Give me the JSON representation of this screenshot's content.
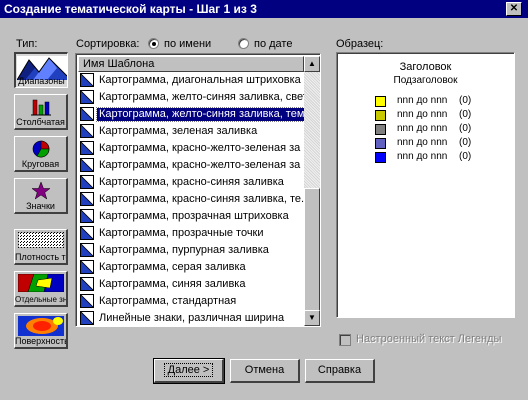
{
  "window": {
    "title": "Создание тематической карты - Шаг 1 из 3",
    "close_glyph": "✕"
  },
  "type_panel": {
    "label": "Тип:",
    "buttons": [
      {
        "label": "Диапазоны",
        "icon": "ranges-icon",
        "selected": true
      },
      {
        "label": "Столбчатая",
        "icon": "bar-chart-icon"
      },
      {
        "label": "Круговая",
        "icon": "pie-chart-icon"
      },
      {
        "label": "Значки",
        "icon": "star-symbol-icon"
      },
      {
        "label": "Плотность точек",
        "icon": "dot-density-icon"
      },
      {
        "label": "Отдельные значения",
        "icon": "individual-values-icon"
      },
      {
        "label": "Поверхность",
        "icon": "grid-surface-icon"
      }
    ]
  },
  "sort": {
    "label": "Сортировка:",
    "by_name": "по имени",
    "by_date": "по дате",
    "selected": "by_name"
  },
  "template_list": {
    "header": "Имя Шаблона",
    "items": [
      "Картограмма, диагональная штриховка",
      "Картограмма, желто-синяя заливка, свет",
      "Картограмма, желто-синяя заливка, тем",
      "Картограмма, зеленая заливка",
      "Картограмма, красно-желто-зеленая за",
      "Картограмма, красно-желто-зеленая за",
      "Картограмма, красно-синяя заливка",
      "Картограмма, красно-синяя заливка, те.",
      "Картограмма, прозрачная штриховка",
      "Картограмма, прозрачные точки",
      "Картограмма, пурпурная заливка",
      "Картограмма, серая заливка",
      "Картограмма, синяя заливка",
      "Картограмма, стандартная",
      "Линейные знаки, различная ширина"
    ],
    "selected_index": 2
  },
  "preview": {
    "label": "Образец:",
    "title": "Заголовок",
    "subtitle": "Подзаголовок",
    "legend": [
      {
        "text": "nnn до nnn",
        "count": "(0)",
        "color": "#ffff00"
      },
      {
        "text": "nnn до nnn",
        "count": "(0)",
        "color": "#c8c800"
      },
      {
        "text": "nnn до nnn",
        "count": "(0)",
        "color": "#808080"
      },
      {
        "text": "nnn до nnn",
        "count": "(0)",
        "color": "#6060c0"
      },
      {
        "text": "nnn до nnn",
        "count": "(0)",
        "color": "#0000ff"
      }
    ]
  },
  "custom_legend_text": {
    "label": "Настроенный текст Легенды",
    "checked": false,
    "enabled": false
  },
  "buttons": {
    "next": "Далее >",
    "cancel": "Отмена",
    "help": "Справка"
  }
}
